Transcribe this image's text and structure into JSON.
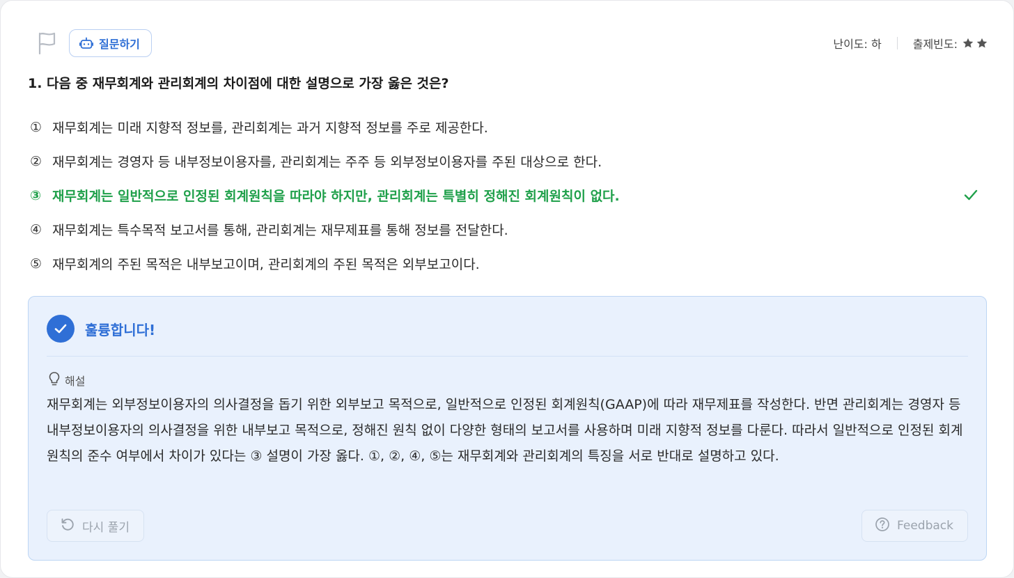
{
  "header": {
    "ask_label": "질문하기",
    "difficulty": "난이도: 하",
    "frequency_label": "출제빈도:",
    "frequency_stars": 2
  },
  "question": {
    "title": "1. 다음 중 재무회계와 관리회계의 차이점에 대한 설명으로 가장 옳은 것은?"
  },
  "options": [
    {
      "num": "①",
      "text": "재무회계는 미래 지향적 정보를, 관리회계는 과거 지향적 정보를 주로 제공한다."
    },
    {
      "num": "②",
      "text": "재무회계는 경영자 등 내부정보이용자를, 관리회계는 주주 등 외부정보이용자를 주된 대상으로 한다."
    },
    {
      "num": "③",
      "text": "재무회계는 일반적으로 인정된 회계원칙을 따라야 하지만, 관리회계는 특별히 정해진 회계원칙이 없다."
    },
    {
      "num": "④",
      "text": "재무회계는 특수목적 보고서를 통해, 관리회계는 재무제표를 통해 정보를 전달한다."
    },
    {
      "num": "⑤",
      "text": "재무회계의 주된 목적은 내부보고이며, 관리회계의 주된 목적은 외부보고이다."
    }
  ],
  "result": {
    "title": "훌륭합니다!",
    "explanation_label": "해설",
    "explanation": "재무회계는 외부정보이용자의 의사결정을 돕기 위한 외부보고 목적으로, 일반적으로 인정된 회계원칙(GAAP)에 따라 재무제표를 작성한다. 반면 관리회계는 경영자 등 내부정보이용자의 의사결정을 위한 내부보고 목적으로, 정해진 원칙 없이 다양한 형태의 보고서를 사용하며 미래 지향적 정보를 다룬다. 따라서 일반적으로 인정된 회계원칙의 준수 여부에서 차이가 있다는 ③ 설명이 가장 옳다. ①, ②, ④, ⑤는 재무회계와 관리회계의 특징을 서로 반대로 설명하고 있다.",
    "retry_label": "다시 풀기",
    "feedback_label": "Feedback"
  },
  "colors": {
    "accent": "#2f6fd6",
    "correct": "#1fa04a",
    "result_bg": "#e9f1fd"
  },
  "icons": [
    "flag-icon",
    "robot-icon",
    "star-icon",
    "check-icon",
    "lightbulb-icon",
    "refresh-icon",
    "question-circle-icon"
  ]
}
